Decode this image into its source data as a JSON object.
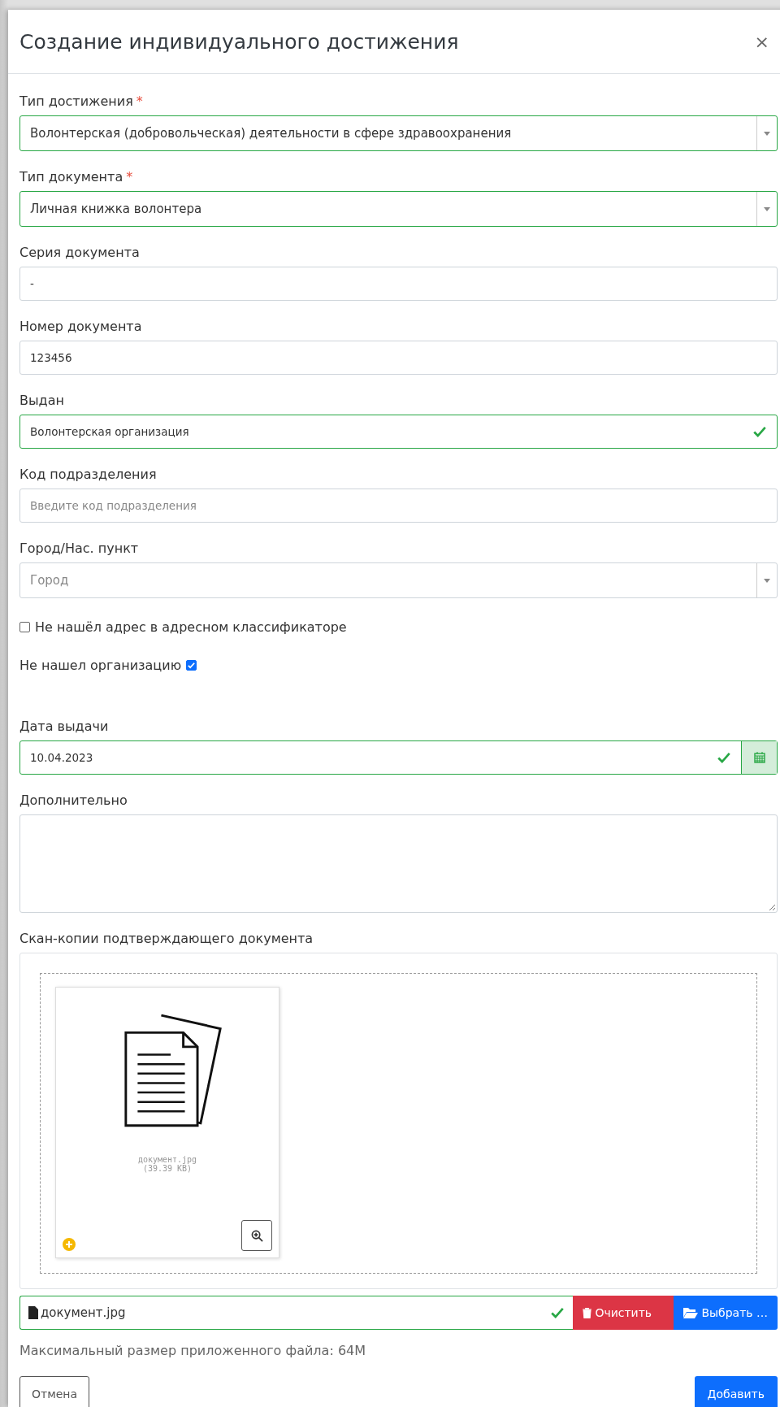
{
  "dialog": {
    "title": "Создание индивидуального достижения",
    "close": "×"
  },
  "fields": [
    {
      "kind": "select",
      "label": "Тип достижения",
      "required_mark": "*",
      "value": "Волонтерская (добровольческая) деятельности в сфере здравоохранения",
      "valid": true
    },
    {
      "kind": "select",
      "label": "Тип документа",
      "required_mark": "*",
      "value": "Личная книжка волонтера",
      "valid": true
    },
    {
      "kind": "input",
      "label": "Серия документа",
      "value": "-",
      "valid": false
    },
    {
      "kind": "input",
      "label": "Номер документа",
      "value": "123456",
      "valid": false
    },
    {
      "kind": "input",
      "label": "Выдан",
      "value": "Волонтерская организация",
      "valid": true
    },
    {
      "kind": "input",
      "label": "Код подразделения",
      "placeholder": "Введите код подразделения",
      "valid": false
    },
    {
      "kind": "select",
      "label": "Город/Нас. пункт",
      "placeholder": "Город",
      "valid": false
    },
    {
      "kind": "checkbox",
      "label": "Не нашёл адрес в адресном классификаторе",
      "checked": false
    },
    {
      "kind": "trailing_checkbox",
      "label": "Не нашел организацию",
      "checked": true
    },
    {
      "kind": "date",
      "label": "Дата выдачи",
      "value": "10.04.2023",
      "valid": true
    },
    {
      "kind": "textarea",
      "label": "Дополнительно",
      "valid": false
    }
  ],
  "upload": {
    "label": "Скан-копии подтверждающего документа",
    "preview": {
      "file_name": "документ.jpg",
      "file_size": "(39.39 KB)"
    },
    "file_field": {
      "value": "документ.jpg",
      "valid": true
    },
    "clear_button": "Очистить",
    "browse_button": "Выбрать …",
    "hint": "Максимальный размер приложенного файла: 64M"
  },
  "buttons": {
    "cancel": "Отмена",
    "submit": "Добавить"
  }
}
